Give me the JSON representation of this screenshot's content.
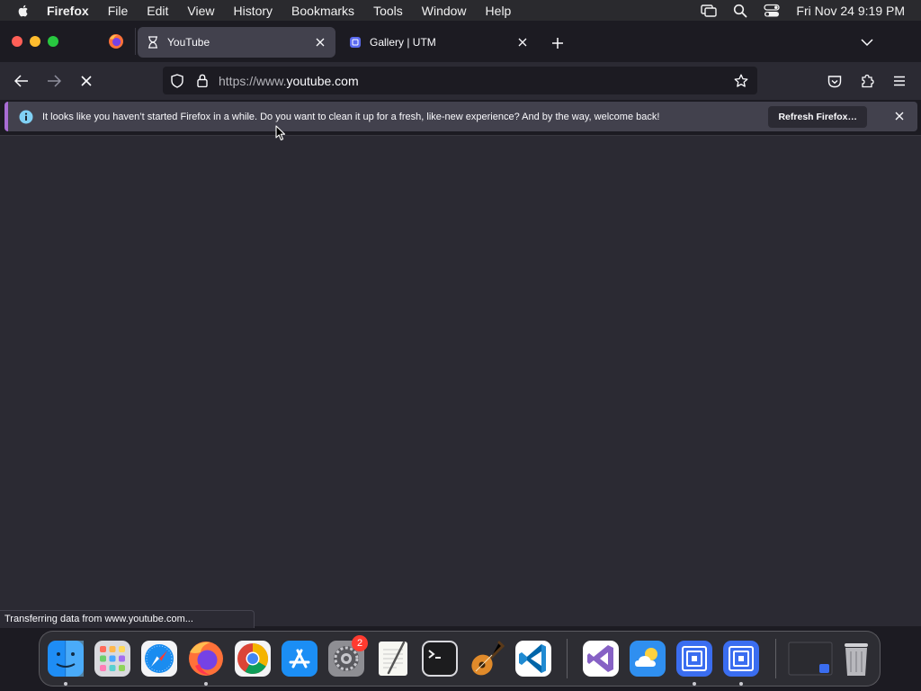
{
  "menubar": {
    "app_name": "Firefox",
    "menus": [
      "File",
      "Edit",
      "View",
      "History",
      "Bookmarks",
      "Tools",
      "Window",
      "Help"
    ],
    "clock": "Fri Nov 24  9:19 PM"
  },
  "tabs": [
    {
      "label": "YouTube",
      "active": true,
      "icon": "hourglass-icon"
    },
    {
      "label": "Gallery | UTM",
      "active": false,
      "icon": "utm-icon"
    }
  ],
  "url": {
    "prefix": "https://www.",
    "domain": "youtube.com"
  },
  "infobar": {
    "message": "It looks like you haven’t started Firefox in a while. Do you want to clean it up for a fresh, like-new experience? And by the way, welcome back!",
    "button": "Refresh Firefox…"
  },
  "status": "Transferring data from www.youtube.com...",
  "dock": {
    "settings_badge": "2"
  },
  "colors": {
    "infobar_accent": "#a86cd3",
    "content_bg": "#2b2a33"
  }
}
